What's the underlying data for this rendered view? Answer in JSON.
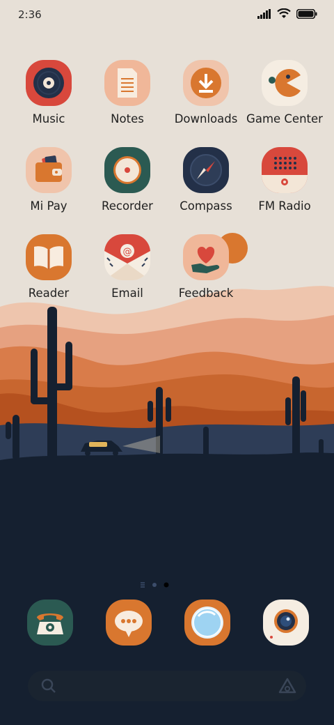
{
  "status_bar": {
    "time": "2:36",
    "icons": [
      "signal-icon",
      "wifi-icon",
      "battery-icon"
    ]
  },
  "apps": [
    {
      "label": "Music",
      "icon": "music-icon"
    },
    {
      "label": "Notes",
      "icon": "notes-icon"
    },
    {
      "label": "Downloads",
      "icon": "downloads-icon"
    },
    {
      "label": "Game Center",
      "icon": "game-center-icon"
    },
    {
      "label": "Mi Pay",
      "icon": "wallet-icon"
    },
    {
      "label": "Recorder",
      "icon": "recorder-icon"
    },
    {
      "label": "Compass",
      "icon": "compass-icon"
    },
    {
      "label": "FM Radio",
      "icon": "radio-icon"
    },
    {
      "label": "Reader",
      "icon": "book-icon"
    },
    {
      "label": "Email",
      "icon": "email-icon"
    },
    {
      "label": "Feedback",
      "icon": "feedback-icon"
    }
  ],
  "dock": [
    {
      "icon": "phone-icon"
    },
    {
      "icon": "messages-icon"
    },
    {
      "icon": "browser-icon"
    },
    {
      "icon": "camera-icon"
    }
  ],
  "page_indicator": {
    "pages": 3,
    "active_index": 2
  },
  "search_bar": {
    "left_icon": "search-icon",
    "right_icon": "assistant-icon"
  },
  "colors": {
    "sky": "#e7e0d7",
    "ground": "#152030",
    "accent_orange": "#d9772f",
    "accent_red": "#d8483c"
  }
}
